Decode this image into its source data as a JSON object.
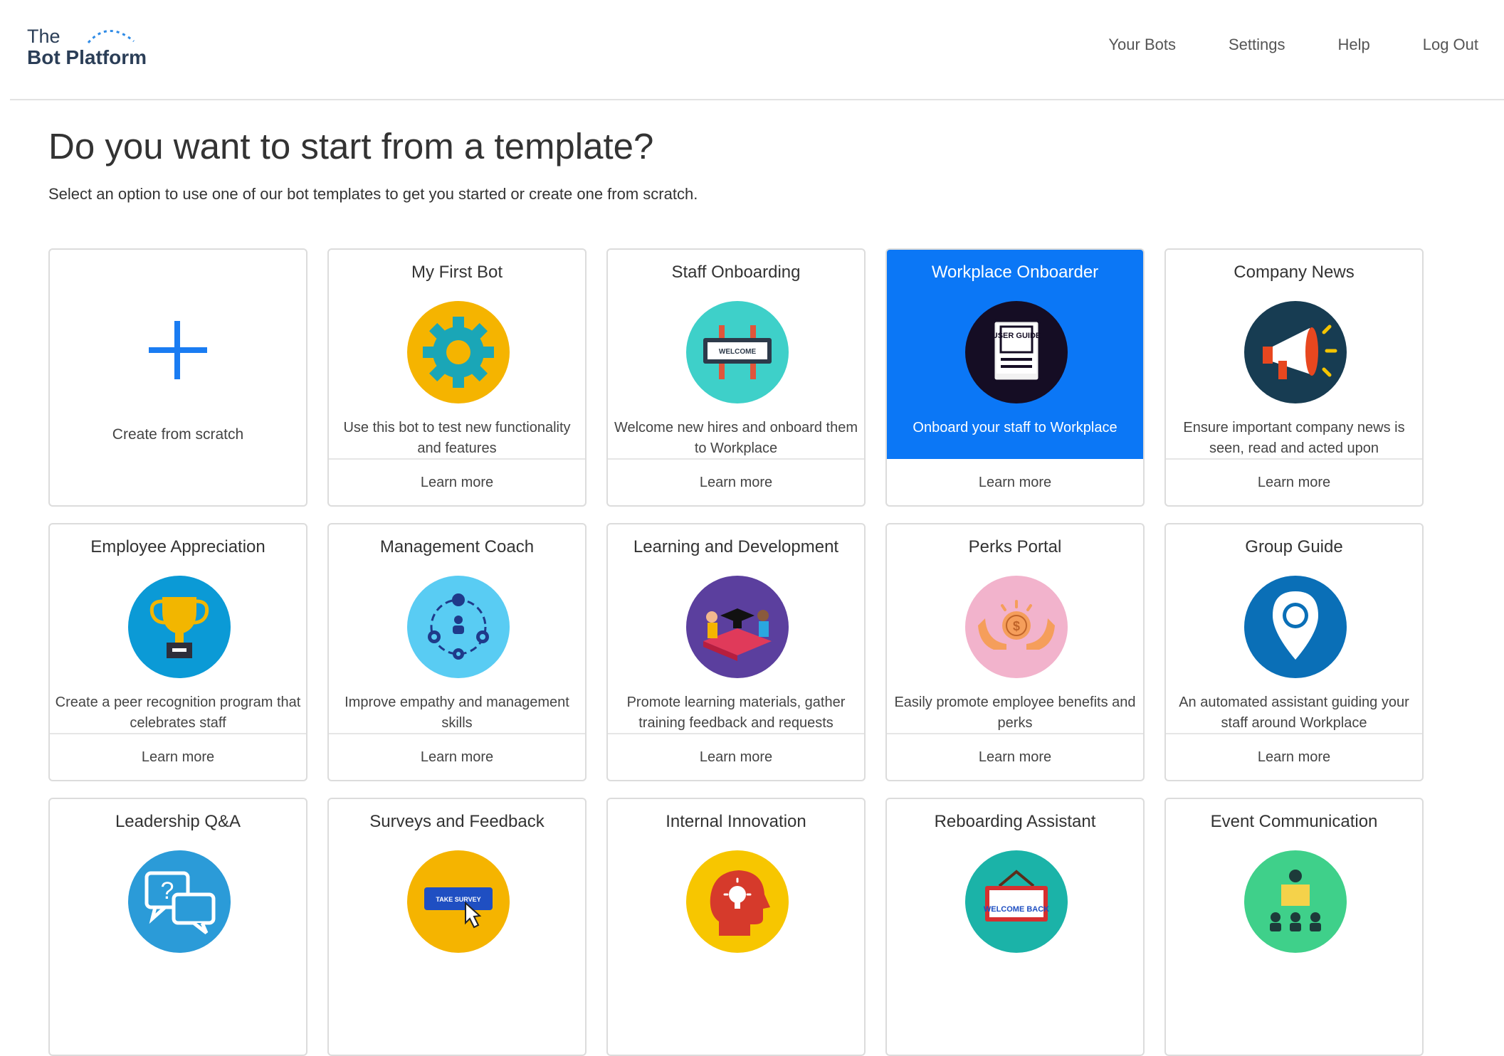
{
  "header": {
    "logo_line1": "The",
    "logo_line2": "Bot Platform",
    "nav": [
      "Your Bots",
      "Settings",
      "Help",
      "Log Out"
    ]
  },
  "page": {
    "title": "Do you want to start from a template?",
    "subtitle": "Select an option to use one of our bot templates to get you started or create one from scratch."
  },
  "scratch_card": {
    "label": "Create from scratch"
  },
  "learn_more_label": "Learn more",
  "templates": [
    {
      "title": "My First Bot",
      "description": "Use this bot to test new functionality and features",
      "icon": "gear-icon"
    },
    {
      "title": "Staff Onboarding",
      "description": "Welcome new hires and onboard them to Workplace",
      "icon": "welcome-sign-icon",
      "icon_text": "WELCOME"
    },
    {
      "title": "Workplace Onboarder",
      "description": "Onboard your staff to Workplace",
      "icon": "user-guide-icon",
      "icon_text": "USER GUIDE",
      "selected": true
    },
    {
      "title": "Company News",
      "description": "Ensure important company news is seen, read and acted upon",
      "icon": "megaphone-icon"
    },
    {
      "title": "Employee Appreciation",
      "description": "Create a peer recognition program that celebrates staff",
      "icon": "trophy-icon"
    },
    {
      "title": "Management Coach",
      "description": "Improve empathy and management skills",
      "icon": "team-network-icon"
    },
    {
      "title": "Learning and Development",
      "description": "Promote learning materials, gather training feedback and requests",
      "icon": "graduation-book-icon"
    },
    {
      "title": "Perks Portal",
      "description": "Easily promote employee benefits and perks",
      "icon": "hands-coin-icon"
    },
    {
      "title": "Group Guide",
      "description": "An automated assistant guiding your staff around Workplace",
      "icon": "map-pin-icon"
    },
    {
      "title": "Leadership Q&A",
      "description": "",
      "icon": "question-chat-icon"
    },
    {
      "title": "Surveys and Feedback",
      "description": "",
      "icon": "take-survey-icon",
      "icon_text": "TAKE SURVEY"
    },
    {
      "title": "Internal Innovation",
      "description": "",
      "icon": "idea-head-icon"
    },
    {
      "title": "Reboarding Assistant",
      "description": "",
      "icon": "welcome-back-icon",
      "icon_text": "WELCOME BACK"
    },
    {
      "title": "Event Communication",
      "description": "",
      "icon": "presenter-audience-icon"
    }
  ],
  "colors": {
    "accent_blue": "#0b77f6",
    "logo_text": "#2b3e57",
    "card_border": "#dcdcdc"
  }
}
